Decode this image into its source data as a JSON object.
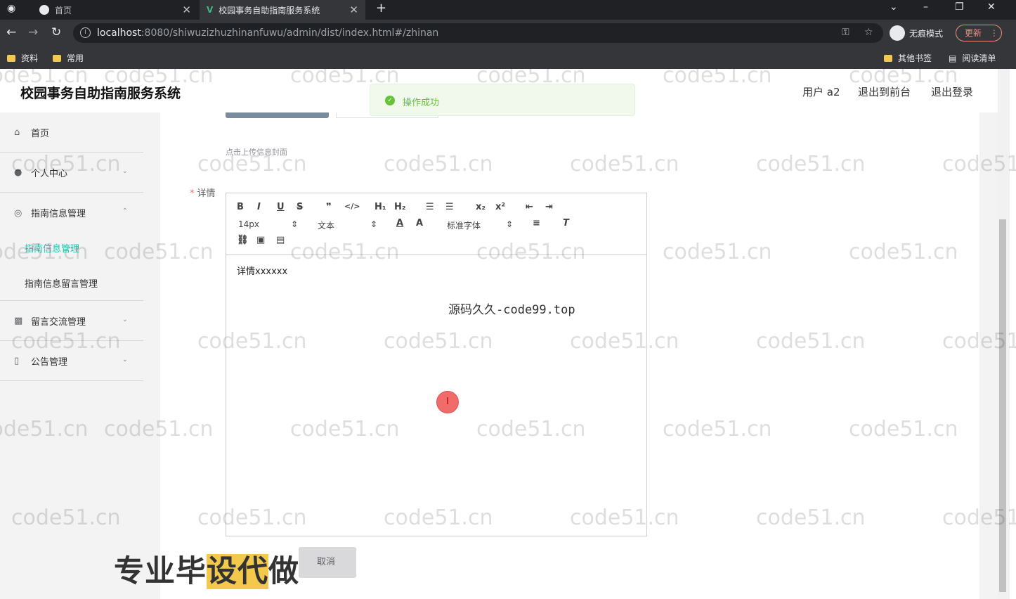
{
  "browser": {
    "tabs": [
      {
        "label": "首页"
      },
      {
        "label": "校园事务自助指南服务系统"
      }
    ],
    "url_host": "localhost",
    "url_rest": ":8080/shiwuzizhuzhinanfuwu/admin/dist/index.html#/zhinan",
    "incognito_label": "无痕模式",
    "update_label": "更新",
    "bookmarks": [
      "资料",
      "常用"
    ],
    "bookmarks_right": [
      "其他书签",
      "阅读清单"
    ]
  },
  "header": {
    "title": "校园事务自助指南服务系统",
    "user": "用户 a2",
    "to_front": "退出到前台",
    "logout": "退出登录"
  },
  "sidebar": {
    "items": [
      {
        "label": "首页"
      },
      {
        "label": "个人中心"
      },
      {
        "label": "指南信息管理"
      },
      {
        "label": "留言交流管理"
      },
      {
        "label": "公告管理"
      }
    ],
    "sub_items": [
      {
        "label": "指南信息管理",
        "active": true
      },
      {
        "label": "指南信息留言管理",
        "active": false
      }
    ],
    "active_color": "#2dbcb2"
  },
  "form": {
    "upload_hint": "点击上传信息封面",
    "detail_label": "详情",
    "editor": {
      "font_size": "14px",
      "block": "文本",
      "font_family": "标准字体",
      "content": "详情xxxxxx"
    },
    "cancel_label": "取消"
  },
  "toast": {
    "message": "操作成功"
  },
  "overlay": {
    "source_text": "源码久久-code99.top",
    "promo_part1": "专业毕",
    "promo_highlight": "设代",
    "promo_part2": "做",
    "watermark": "code51.cn"
  }
}
